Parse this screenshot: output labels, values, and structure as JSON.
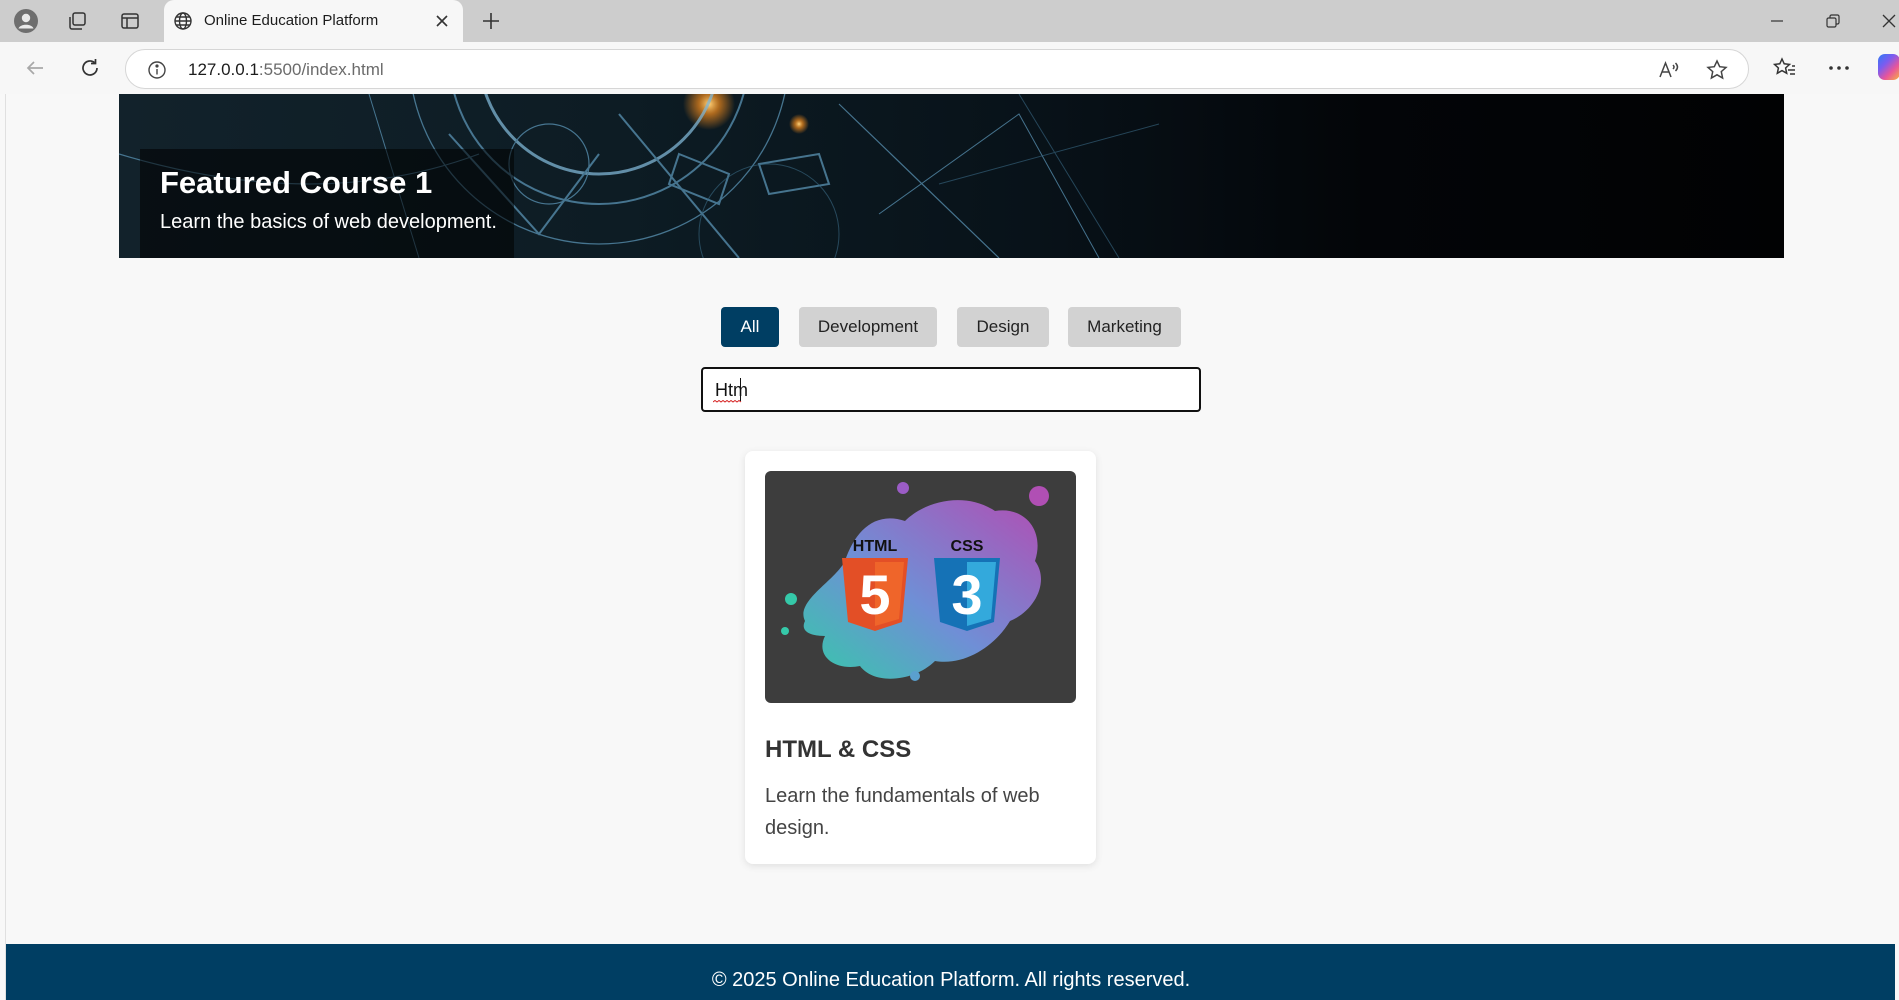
{
  "browser": {
    "tab_title": "Online Education Platform",
    "url_host": "127.0.0.1",
    "url_path": ":5500/index.html"
  },
  "hero": {
    "title": "Featured Course 1",
    "subtitle": "Learn the basics of web development."
  },
  "filters": [
    {
      "label": "All",
      "active": true
    },
    {
      "label": "Development",
      "active": false
    },
    {
      "label": "Design",
      "active": false
    },
    {
      "label": "Marketing",
      "active": false
    }
  ],
  "search": {
    "value": "Htm"
  },
  "course_card": {
    "image_logos": [
      "HTML",
      "CSS"
    ],
    "image_numbers": [
      "5",
      "3"
    ],
    "title": "HTML & CSS",
    "description": "Learn the fundamentals of web design."
  },
  "footer": {
    "text": "© 2025 Online Education Platform. All rights reserved."
  },
  "colors": {
    "primary": "#003e63",
    "filter_inactive": "#d2d2d2",
    "page_bg": "#f8f8f8"
  }
}
